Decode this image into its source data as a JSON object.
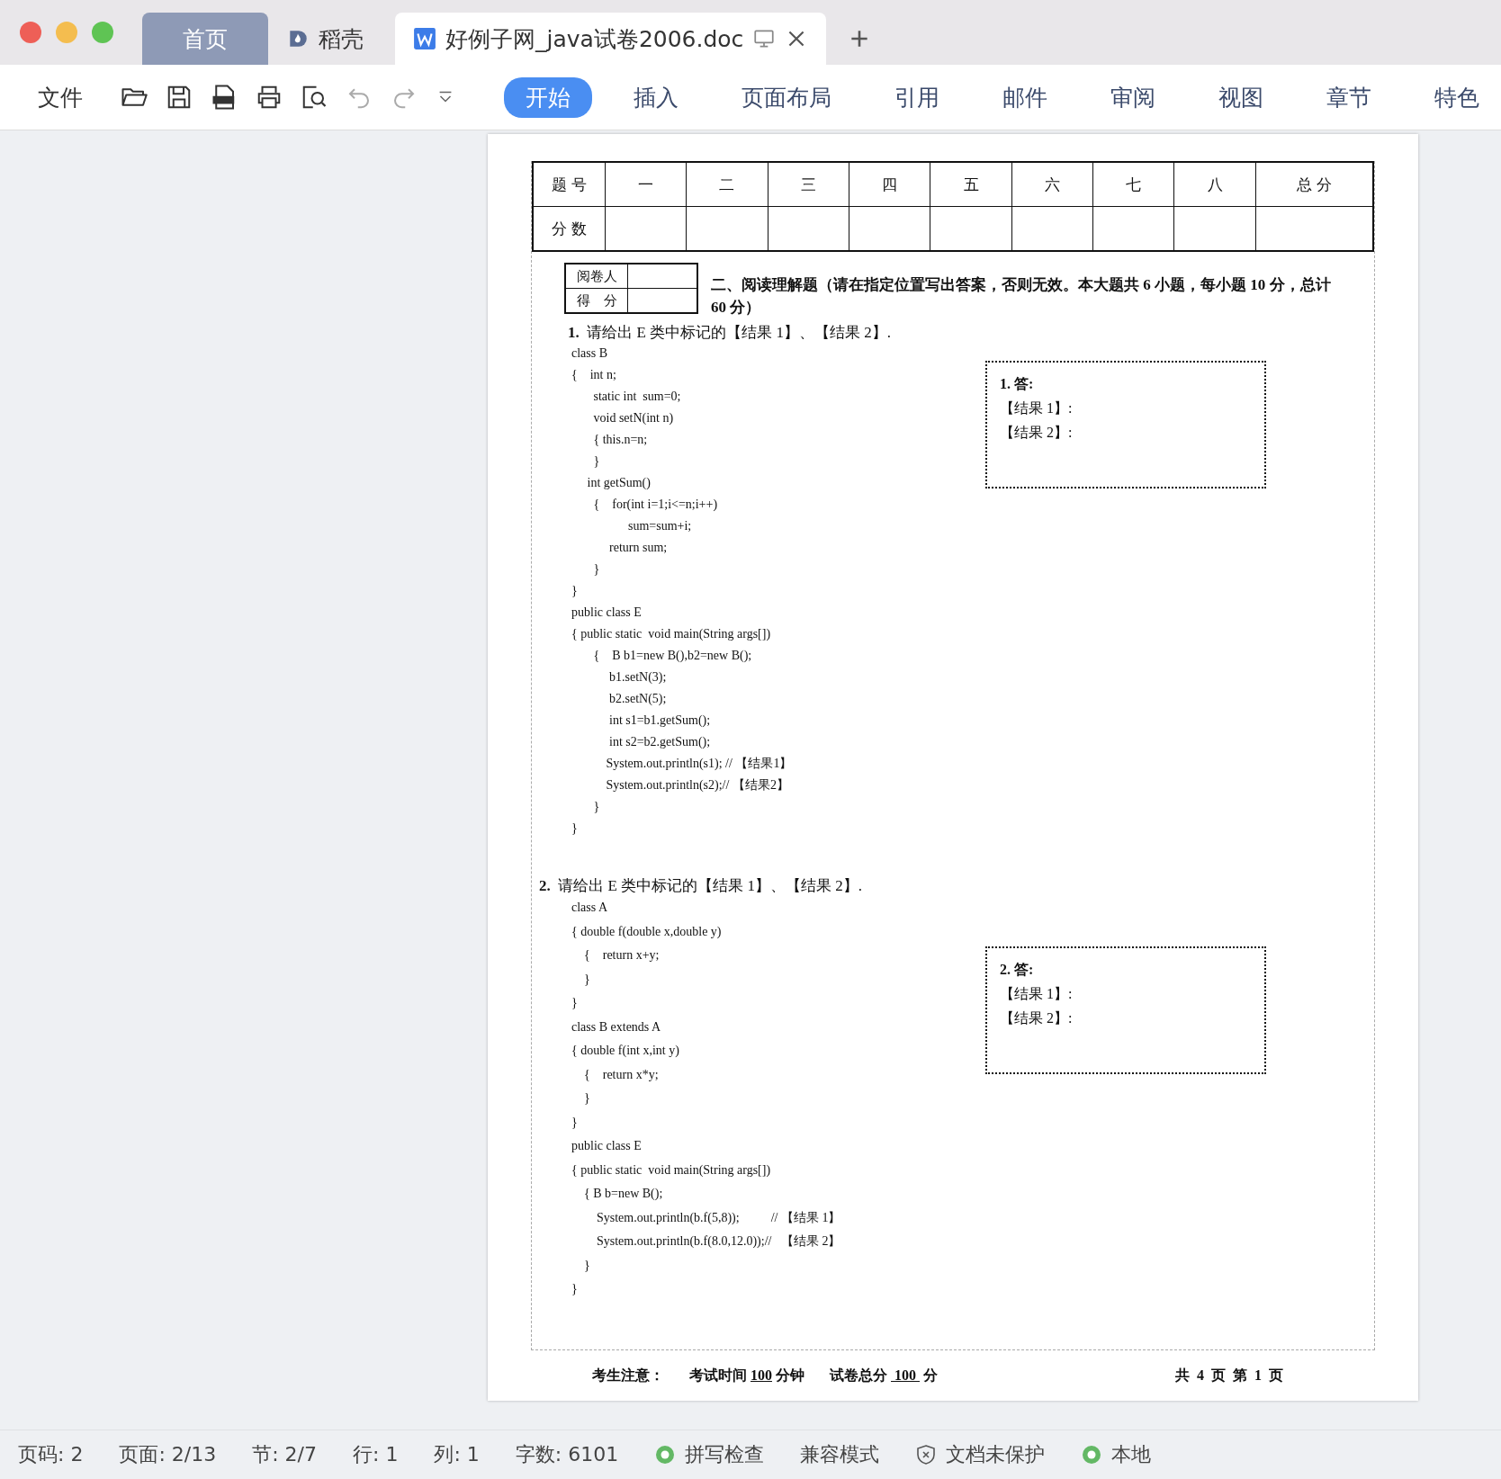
{
  "window": {
    "tabs": [
      {
        "label": "首页",
        "kind": "home",
        "selected": false
      },
      {
        "label": "稻壳",
        "kind": "docer",
        "selected": false
      },
      {
        "label": "好例子网_java试卷2006.doc",
        "kind": "doc",
        "selected": true
      }
    ]
  },
  "toolbar": {
    "file_menu": "文件",
    "ribbon_tabs": [
      {
        "label": "开始",
        "selected": true
      },
      {
        "label": "插入",
        "selected": false
      },
      {
        "label": "页面布局",
        "selected": false
      },
      {
        "label": "引用",
        "selected": false
      },
      {
        "label": "邮件",
        "selected": false
      },
      {
        "label": "审阅",
        "selected": false
      },
      {
        "label": "视图",
        "selected": false
      },
      {
        "label": "章节",
        "selected": false
      },
      {
        "label": "特色",
        "selected": false
      }
    ]
  },
  "document": {
    "score_table": {
      "headers": [
        "题 号",
        "一",
        "二",
        "三",
        "四",
        "五",
        "六",
        "七",
        "八",
        "总 分"
      ],
      "row_label": "分 数"
    },
    "grader_table": [
      "阅卷人",
      "得　分"
    ],
    "section_title": "二、阅读理解题（请在指定位置写出答案，否则无效。本大题共 6 小题，每小题 10 分，总计 60 分）",
    "questions": [
      {
        "number": "1.",
        "prompt": "请给出 E 类中标记的【结果 1】、【结果 2】.",
        "code": [
          "class B",
          "{    int n;",
          "       static int  sum=0;",
          "       void setN(int n)",
          "       { this.n=n;",
          "       }",
          "     int getSum()",
          "       {    for(int i=1;i<=n;i++)",
          "                  sum=sum+i;",
          "            return sum;",
          "       }",
          "}",
          "public class E",
          "{ public static  void main(String args[])",
          "       {    B b1=new B(),b2=new B();",
          "            b1.setN(3);",
          "            b2.setN(5);",
          "            int s1=b1.getSum();",
          "            int s2=b2.getSum();",
          "           System.out.println(s1); // 【结果1】",
          "           System.out.println(s2);// 【结果2】",
          "       }",
          "}"
        ],
        "answer": {
          "title": "1.  答:",
          "lines": [
            "【结果 1】:",
            "【结果 2】:"
          ]
        }
      },
      {
        "number": "2.",
        "prompt": "请给出 E 类中标记的【结果 1】、【结果 2】.",
        "code": [
          "class A",
          "{ double f(double x,double y)",
          "    {    return x+y;",
          "    }",
          "}",
          "class B extends A",
          "{ double f(int x,int y)",
          "    {    return x*y;",
          "    }",
          "}",
          "public class E",
          "{ public static  void main(String args[])",
          "    { B b=new B();",
          "        System.out.println(b.f(5,8));          // 【结果 1】",
          "        System.out.println(b.f(8.0,12.0));//   【结果 2】",
          "    }",
          "}"
        ],
        "answer": {
          "title": "2.  答:",
          "lines": [
            "【结果 1】:",
            "【结果 2】:"
          ]
        }
      }
    ],
    "footer": {
      "notice": "考生注意：",
      "time_label": "考试时间",
      "time_value": "100",
      "time_unit": "分钟",
      "total_label": "试卷总分",
      "total_value": "100",
      "total_unit": "分",
      "pages": "共  4  页  第  1  页"
    }
  },
  "status_bar": [
    {
      "kind": "text",
      "label": "页码: 2"
    },
    {
      "kind": "text",
      "label": "页面: 2/13"
    },
    {
      "kind": "text",
      "label": "节: 2/7"
    },
    {
      "kind": "text",
      "label": "行: 1"
    },
    {
      "kind": "text",
      "label": "列: 1"
    },
    {
      "kind": "text",
      "label": "字数: 6101"
    },
    {
      "kind": "check",
      "label": "拼写检查"
    },
    {
      "kind": "text",
      "label": "兼容模式"
    },
    {
      "kind": "shield",
      "label": "文档未保护"
    },
    {
      "kind": "check",
      "label": "本地"
    }
  ]
}
